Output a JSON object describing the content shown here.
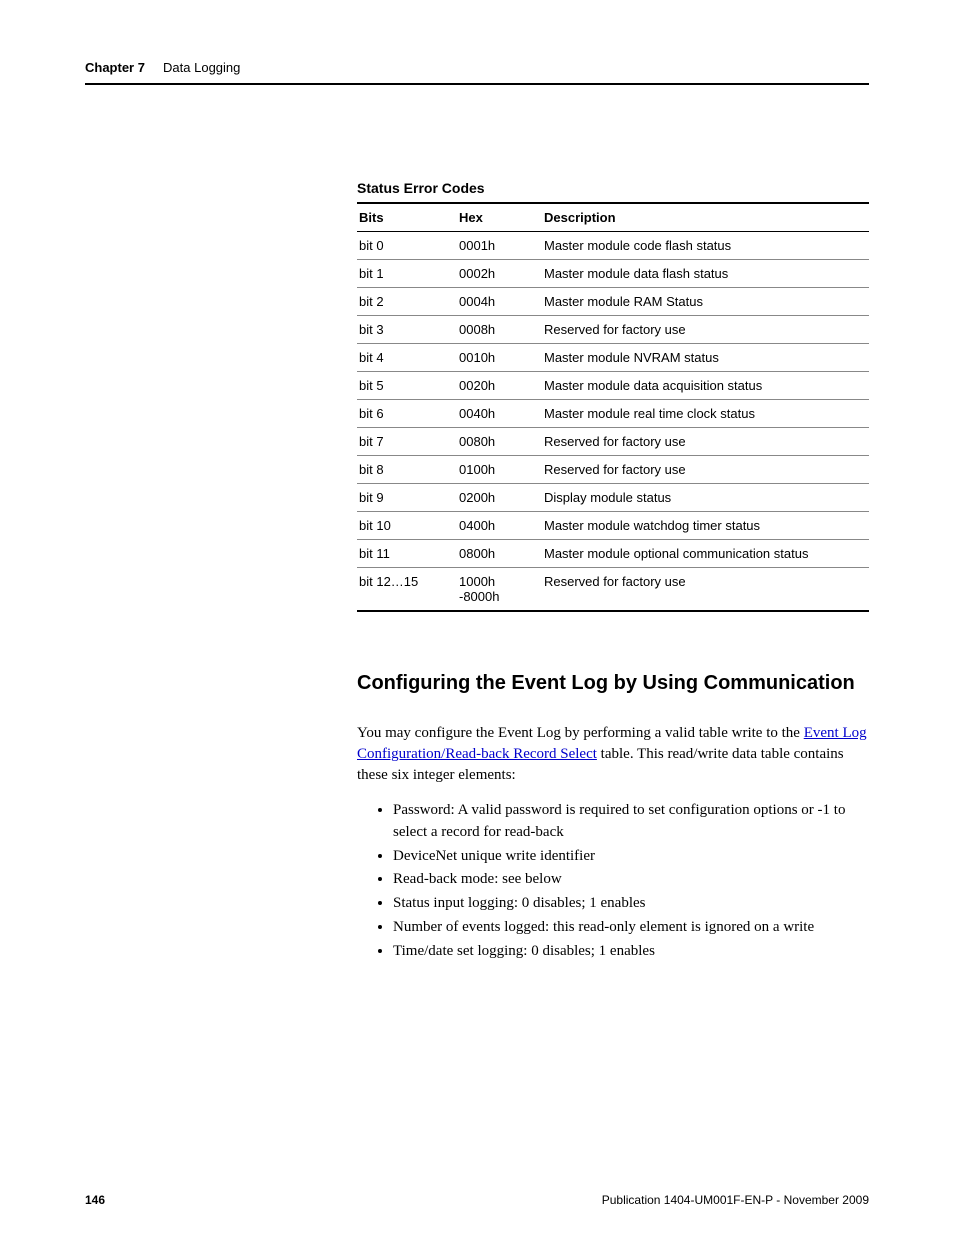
{
  "header": {
    "chapter_label": "Chapter 7",
    "chapter_title": "Data Logging"
  },
  "table": {
    "title": "Status Error Codes",
    "columns": [
      "Bits",
      "Hex",
      "Description"
    ],
    "rows": [
      {
        "bits": "bit 0",
        "hex": "0001h",
        "desc": "Master module code flash status"
      },
      {
        "bits": "bit 1",
        "hex": "0002h",
        "desc": "Master module data flash status"
      },
      {
        "bits": "bit 2",
        "hex": "0004h",
        "desc": "Master module RAM Status"
      },
      {
        "bits": "bit 3",
        "hex": "0008h",
        "desc": "Reserved for factory use"
      },
      {
        "bits": "bit 4",
        "hex": "0010h",
        "desc": "Master module NVRAM status"
      },
      {
        "bits": "bit 5",
        "hex": "0020h",
        "desc": "Master module data acquisition status"
      },
      {
        "bits": "bit 6",
        "hex": "0040h",
        "desc": "Master module real time clock status"
      },
      {
        "bits": "bit 7",
        "hex": "0080h",
        "desc": "Reserved for factory use"
      },
      {
        "bits": "bit 8",
        "hex": "0100h",
        "desc": "Reserved for factory use"
      },
      {
        "bits": "bit 9",
        "hex": "0200h",
        "desc": "Display module status"
      },
      {
        "bits": "bit 10",
        "hex": "0400h",
        "desc": "Master module watchdog timer status"
      },
      {
        "bits": "bit 11",
        "hex": "0800h",
        "desc": "Master module optional communication status"
      },
      {
        "bits": "bit 12…15",
        "hex": "1000h -8000h",
        "desc": "Reserved for factory use"
      }
    ]
  },
  "section": {
    "heading": "Configuring the Event Log by Using Communication",
    "para_before_link": "You may configure the Event Log by performing a valid table write to the ",
    "link_text": "Event Log Configuration/Read-back Record Select",
    "para_after_link": " table. This read/write data table contains these six integer elements:",
    "bullets": [
      "Password: A valid password is required to set configuration options or -1 to select a record for read-back",
      "DeviceNet unique write identifier",
      "Read-back mode: see below",
      "Status input logging: 0 disables; 1 enables",
      "Number of events logged: this read-only element is ignored on a write",
      "Time/date set logging: 0 disables; 1 enables"
    ]
  },
  "footer": {
    "page_number": "146",
    "publication": "Publication 1404-UM001F-EN-P - November 2009"
  },
  "chart_data": {
    "type": "table",
    "title": "Status Error Codes",
    "columns": [
      "Bits",
      "Hex",
      "Description"
    ],
    "rows": [
      [
        "bit 0",
        "0001h",
        "Master module code flash status"
      ],
      [
        "bit 1",
        "0002h",
        "Master module data flash status"
      ],
      [
        "bit 2",
        "0004h",
        "Master module RAM Status"
      ],
      [
        "bit 3",
        "0008h",
        "Reserved for factory use"
      ],
      [
        "bit 4",
        "0010h",
        "Master module NVRAM status"
      ],
      [
        "bit 5",
        "0020h",
        "Master module data acquisition status"
      ],
      [
        "bit 6",
        "0040h",
        "Master module real time clock status"
      ],
      [
        "bit 7",
        "0080h",
        "Reserved for factory use"
      ],
      [
        "bit 8",
        "0100h",
        "Reserved for factory use"
      ],
      [
        "bit 9",
        "0200h",
        "Display module status"
      ],
      [
        "bit 10",
        "0400h",
        "Master module watchdog timer status"
      ],
      [
        "bit 11",
        "0800h",
        "Master module optional communication status"
      ],
      [
        "bit 12…15",
        "1000h -8000h",
        "Reserved for factory use"
      ]
    ]
  }
}
